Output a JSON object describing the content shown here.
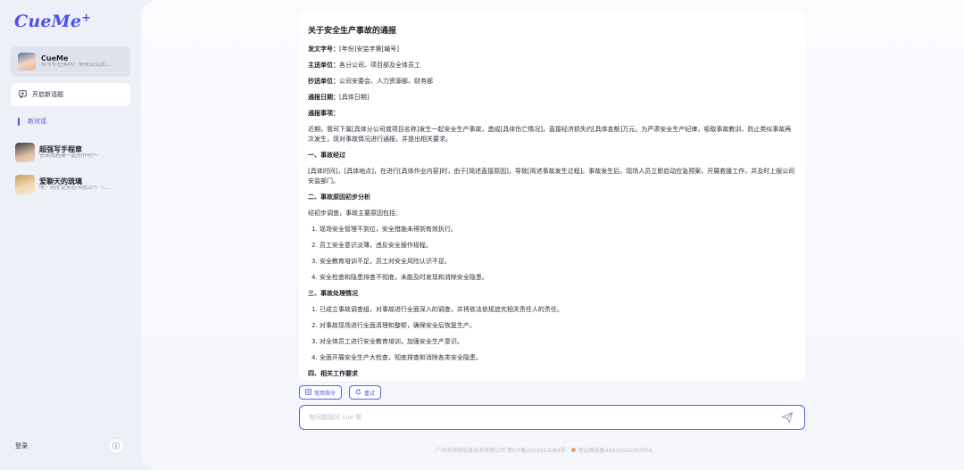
{
  "app": {
    "logo_text": "CueMe",
    "logo_suffix": "+"
  },
  "sidebar": {
    "assistant": {
      "title": "CueMe",
      "subtitle": "有写作任务吗？快来试试我..."
    },
    "new_topic_label": "开启新话题",
    "new_dialog_label": "新对话",
    "history": [
      {
        "title": "超强写手程章",
        "subtitle": "快来找程章一起创作吧～"
      },
      {
        "title": "爱聊天的琉璃",
        "subtitle": "嘿？刚才是你在叫我么～（..."
      }
    ],
    "login_label": "登录",
    "info_icon": "ⓘ"
  },
  "document": {
    "title": "关于安全生产事故的通报",
    "fields": [
      {
        "label": "发文字号：",
        "value": "[年份]安监字第[编号]"
      },
      {
        "label": "主送单位：",
        "value": "各分公司、项目部及全体员工"
      },
      {
        "label": "抄送单位：",
        "value": "公司安委会、人力资源部、财务部"
      },
      {
        "label": "通报日期：",
        "value": "[具体日期]"
      },
      {
        "label": "通报事项：",
        "value": ""
      }
    ],
    "intro": "近期，我司下属[具体分公司或项目名称]发生一起安全生产事故，造成[具体伤亡情况]，直接经济损失约[具体金额]万元。为严肃安全生产纪律，吸取事故教训，防止类似事故再次发生，现对事故情况进行通报，并提出相关要求。",
    "section1_title": "一、事故经过",
    "section1_text": "[具体时间]，[具体地点]，在进行[具体作业内容]时，由于[简述直接原因]，导致[简述事故发生过程]。事故发生后，现场人员立即启动应急预案，开展救援工作，并及时上报公司安监部门。",
    "section2_title": "二、事故原因初步分析",
    "section2_intro": "经初步调查，事故主要原因包括：",
    "section2_items": [
      "1. 现场安全管理不到位，安全措施未得到有效执行。",
      "2. 员工安全意识淡薄，违反安全操作规程。",
      "3. 安全教育培训不足，员工对安全风险认识不足。",
      "4. 安全检查和隐患排查不彻底，未能及时发现和消除安全隐患。"
    ],
    "section3_title": "三、事故处理情况",
    "section3_items": [
      "1. 已成立事故调查组，对事故进行全面深入的调查，并将依法依规追究相关责任人的责任。",
      "2. 对事故现场进行全面清理和整顿，确保安全后恢复生产。",
      "3. 对全体员工进行安全教育培训，加强安全生产意识。",
      "4. 全面开展安全生产大检查，彻底排查和消除各类安全隐患。"
    ],
    "section4_title": "四、相关工作要求"
  },
  "toolbar": {
    "common_cmd_label": "常用指令",
    "retry_label": "重试"
  },
  "input": {
    "placeholder": "有问题就问 cue 我"
  },
  "footer": {
    "company": "广州市动悦信息技术有限公司 粤ICP备2022013084号",
    "police": "粤公网安备44010502003055"
  },
  "colors": {
    "accent": "#4c4ff0",
    "sidebar_bg": "#eef0f7",
    "main_bg": "#fbfbfe"
  }
}
